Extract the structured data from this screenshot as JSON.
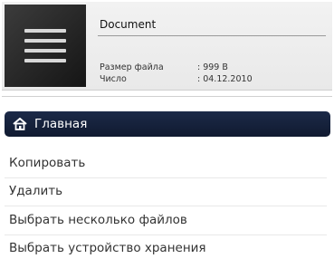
{
  "file": {
    "title": "Document",
    "size_label": "Размер файла",
    "size_value": ": 999 B",
    "date_label": "Число",
    "date_value": ": 04.12.2010"
  },
  "menu": {
    "header": "Главная",
    "header_icon": "home-icon",
    "items": [
      {
        "label": "Копировать"
      },
      {
        "label": "Удалить"
      },
      {
        "label": "Выбрать несколько файлов"
      },
      {
        "label": "Выбрать устройство хранения"
      }
    ]
  },
  "colors": {
    "header_bg": "#16223c",
    "thumbnail_bg": "#2a2a2a",
    "text": "#333333"
  }
}
